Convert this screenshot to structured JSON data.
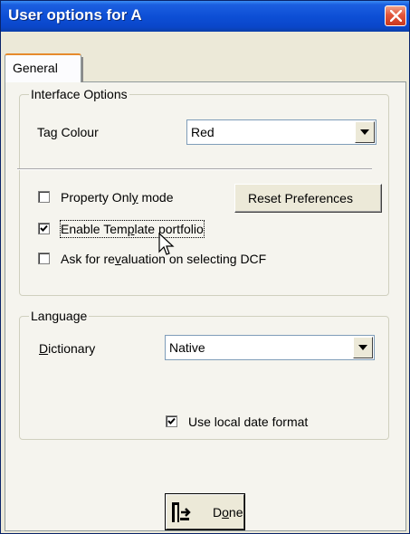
{
  "window": {
    "title": "User options for A"
  },
  "tabs": [
    {
      "label": "General",
      "active": true
    }
  ],
  "interface_options": {
    "legend": "Interface Options",
    "tag_colour": {
      "label_pre": "Ta",
      "label_mnemonic": "g",
      "label_post": " Colour",
      "value": "Red"
    },
    "property_only": {
      "label_pre": "Property Onl",
      "label_mnemonic": "y",
      "label_post": " mode",
      "checked": false
    },
    "reset_button": {
      "label": "Reset Preferences"
    },
    "enable_template": {
      "label_pre": "Enable Tem",
      "label_mnemonic": "p",
      "label_post": "late portfolio",
      "checked": true
    },
    "ask_revaluation": {
      "label_pre": "Ask for re",
      "label_mnemonic": "v",
      "label_post": "aluation on selecting DCF",
      "checked": false
    }
  },
  "language": {
    "legend": "Language",
    "dictionary": {
      "label_pre": "",
      "label_mnemonic": "D",
      "label_post": "ictionary",
      "value": "Native"
    },
    "local_date": {
      "label": "Use local date format",
      "checked": true
    }
  },
  "done_button": {
    "label_pre": "D",
    "label_mnemonic": "o",
    "label_post": "ne"
  },
  "colors": {
    "title_bar": "#0a46c9",
    "close_button": "#e2553a",
    "tab_highlight": "#e68b2c",
    "dialog_bg": "#ece9d8"
  }
}
